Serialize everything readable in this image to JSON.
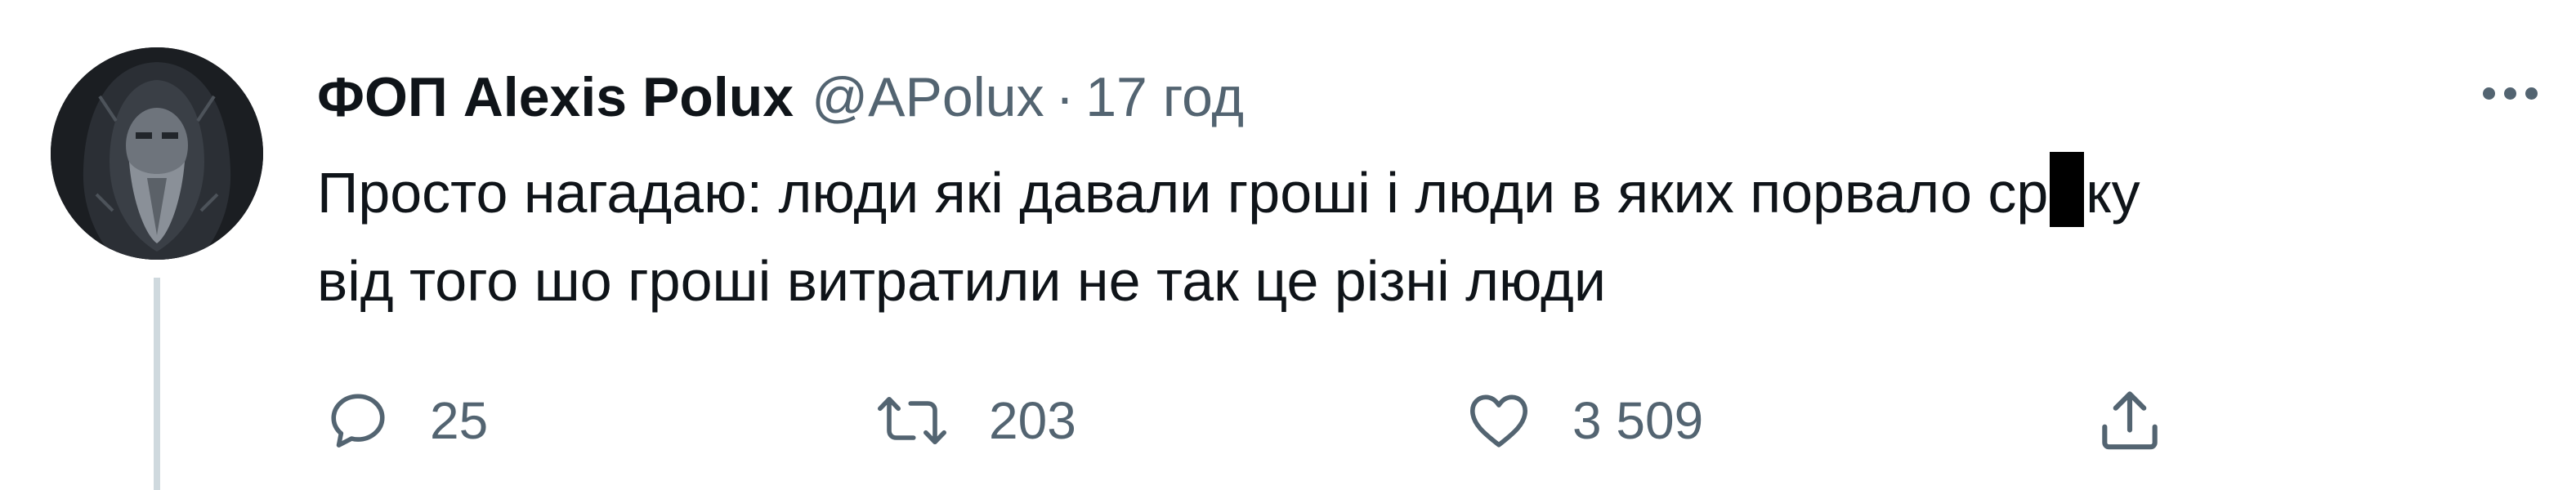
{
  "tweet": {
    "display_name": "ФОП Alexis Polux",
    "handle": "@APolux",
    "separator": "·",
    "time": "17 год",
    "text_line1_before": "Просто нагадаю: люди які давали гроші і люди в яких порвало ср",
    "text_line1_after": "ку",
    "text_line2": "від того шо гроші витратили не так це різні люди",
    "avatar_icon": "avatar-icon",
    "more_icon": "more-icon"
  },
  "actions": {
    "reply": {
      "icon": "reply-icon",
      "count": "25"
    },
    "retweet": {
      "icon": "retweet-icon",
      "count": "203"
    },
    "like": {
      "icon": "heart-icon",
      "count": "3 509"
    },
    "share": {
      "icon": "share-icon"
    }
  },
  "colors": {
    "text": "#0f1419",
    "secondary": "#536471",
    "thread_line": "#cfd9de",
    "redaction": "#000000"
  }
}
